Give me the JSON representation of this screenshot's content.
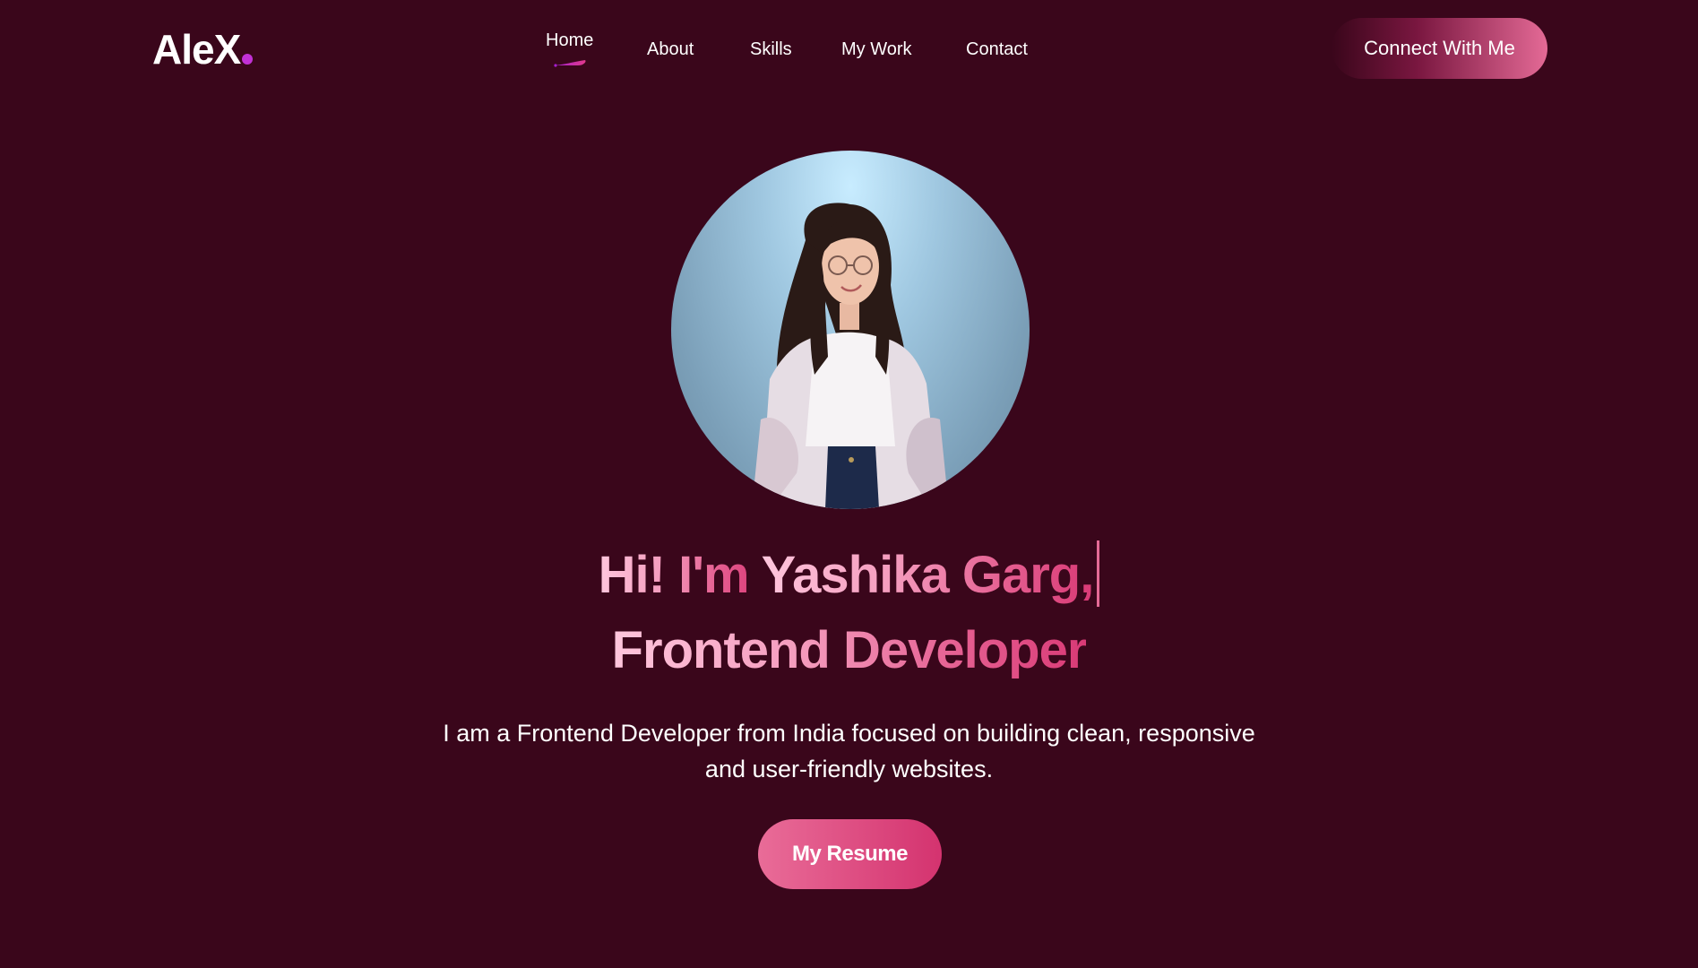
{
  "header": {
    "logo": "AleX",
    "nav": [
      {
        "label": "Home"
      },
      {
        "label": "About"
      },
      {
        "label": "Skills"
      },
      {
        "label": "My Work"
      },
      {
        "label": "Contact"
      }
    ],
    "cta_label": "Connect With Me"
  },
  "hero": {
    "greeting_prefix": "Hi! I'm ",
    "name": "Yashika Garg,",
    "role": "Frontend Developer",
    "description": "I am a Frontend Developer from India focused on building clean, responsive and user-friendly websites.",
    "resume_label": "My Resume",
    "avatar_icon": "profile-photo"
  },
  "colors": {
    "background": "#3a061b",
    "accent": "#e46a96",
    "accent_dark": "#d4336f",
    "logo_dot": "#c231d6"
  }
}
